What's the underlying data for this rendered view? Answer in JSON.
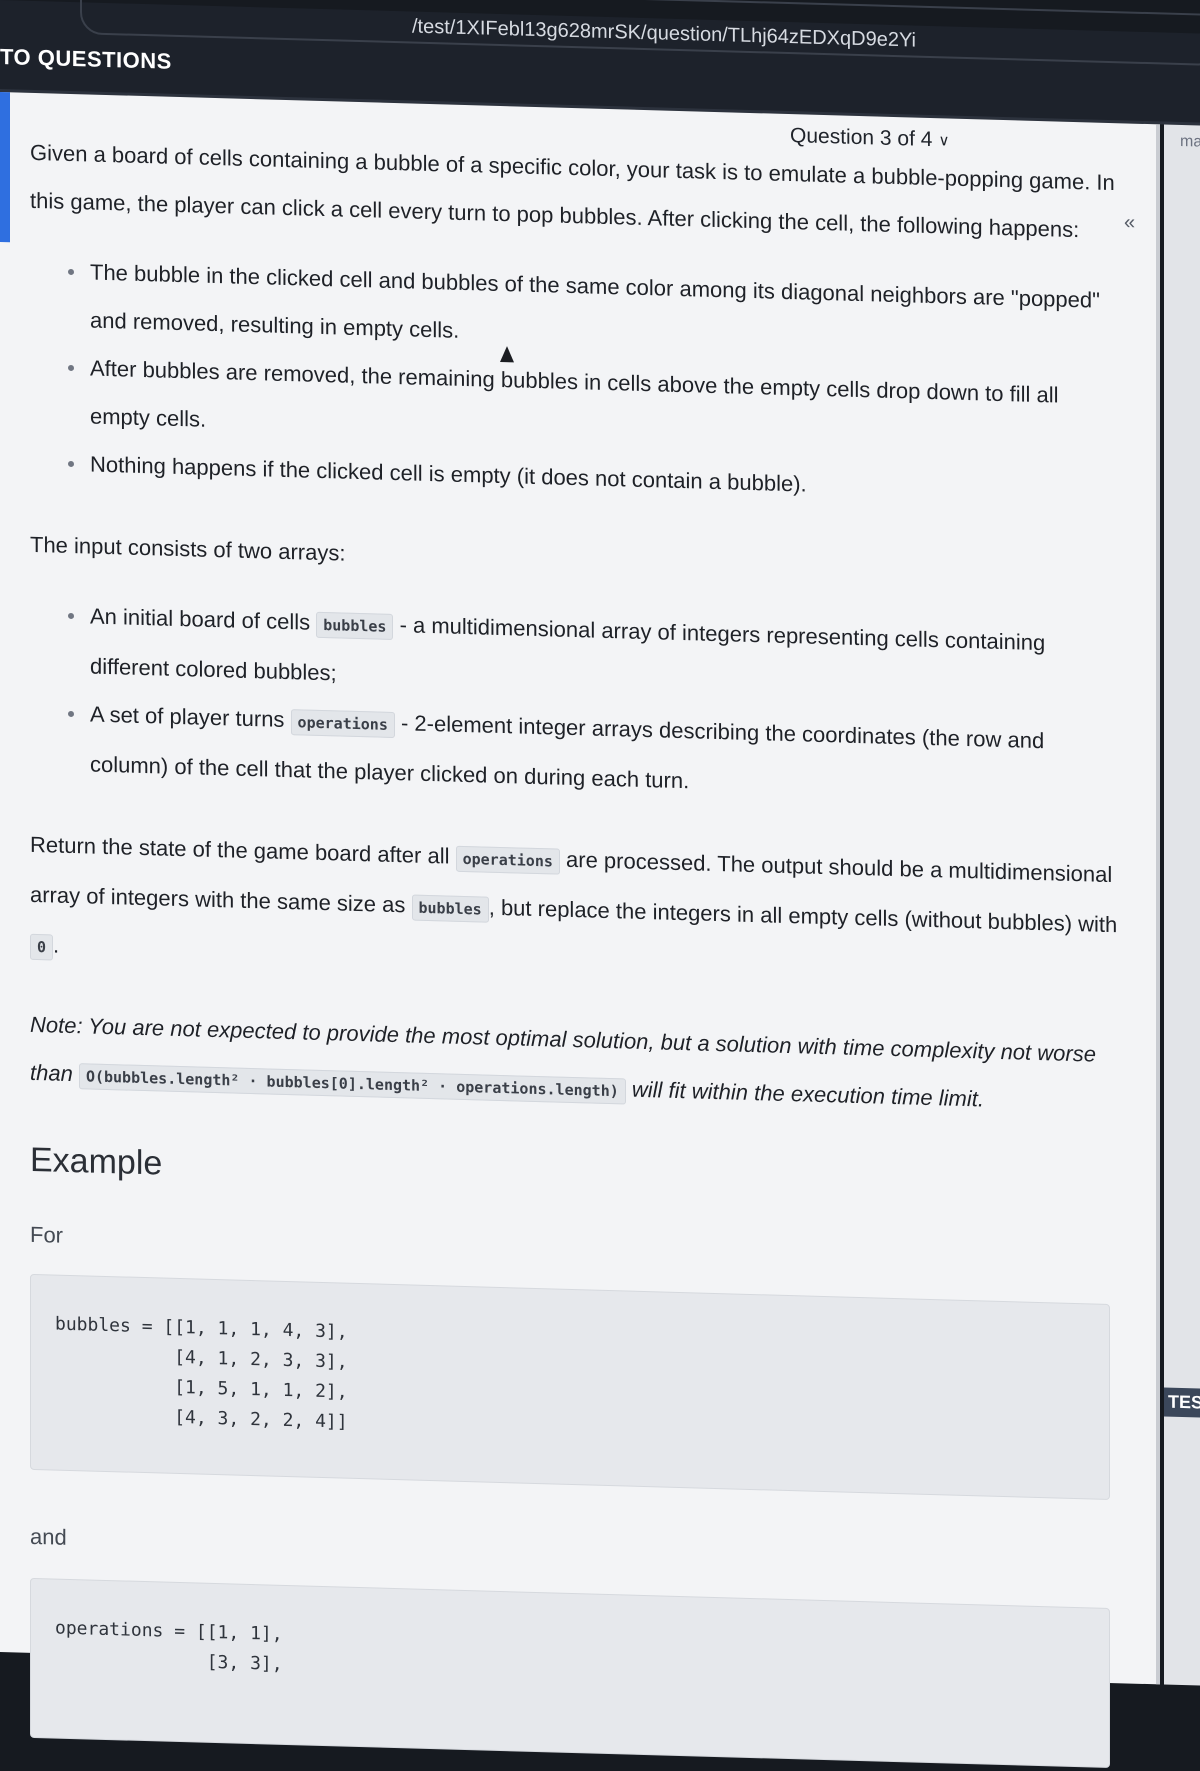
{
  "browser": {
    "url": "/test/1XIFebl13g628mrSK/question/TLhj64zEDXqD9e2Yi"
  },
  "header": {
    "back_link": "TO QUESTIONS"
  },
  "question_nav": {
    "label": "Question 3 of 4"
  },
  "sidebar_right": {
    "top_label": "ma",
    "bottom_label": "TEST"
  },
  "description": {
    "intro": "Given a board of cells containing a bubble of a specific color, your task is to emulate a bubble-popping game. In this game, the player can click a cell every turn to pop bubbles. After clicking the cell, the following happens:",
    "rules": [
      "The bubble in the clicked cell and bubbles of the same color among its diagonal neighbors are \"popped\" and removed, resulting in empty cells.",
      "After bubbles are removed, the remaining bubbles in cells above the empty cells drop down to fill all empty cells.",
      "Nothing happens if the clicked cell is empty (it does not contain a bubble)."
    ],
    "input_heading": "The input consists of two arrays:",
    "input_items": [
      {
        "pre": "An initial board of cells ",
        "code": "bubbles",
        "post": " - a multidimensional array of integers representing cells containing different colored bubbles;"
      },
      {
        "pre": "A set of player turns ",
        "code": "operations",
        "post": " - 2-element integer arrays describing the coordinates (the row and column) of the cell that the player clicked on during each turn."
      }
    ],
    "return_text": {
      "p1": "Return the state of the game board after all ",
      "c1": "operations",
      "p2": " are processed. The output should be a multidimensional array of integers with the same size as ",
      "c2": "bubbles",
      "p3": ", but replace the integers in all empty cells (without bubbles) with ",
      "c3": "0",
      "p4": "."
    },
    "note": {
      "p1": "Note: You are not expected to provide the most optimal solution, but a solution with time complexity not worse than ",
      "c1": "O(bubbles.length² · bubbles[0].length² · operations.length)",
      "p2": " will fit within the execution time limit."
    }
  },
  "example": {
    "heading": "Example",
    "for_label": "For",
    "bubbles_code": "bubbles = [[1, 1, 1, 4, 3],\n           [4, 1, 2, 3, 3],\n           [1, 5, 1, 1, 2],\n           [4, 3, 2, 2, 4]]",
    "and_label": "and",
    "operations_code": "operations = [[1, 1],\n              [3, 3],"
  }
}
